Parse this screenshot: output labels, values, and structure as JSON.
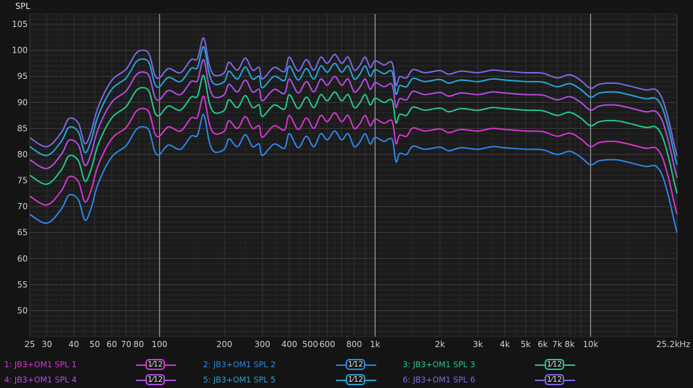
{
  "chart_data": {
    "type": "line",
    "ylabel": "SPL",
    "x_unit_label": "Hz",
    "x_scale": "log",
    "xlim": [
      25,
      25200
    ],
    "ylim": [
      45,
      107
    ],
    "grid": true,
    "y_ticks": [
      50,
      55,
      60,
      65,
      70,
      75,
      80,
      85,
      90,
      95,
      100,
      105
    ],
    "x_ticks": [
      {
        "f": 25,
        "label": "25"
      },
      {
        "f": 30,
        "label": "30"
      },
      {
        "f": 40,
        "label": "40"
      },
      {
        "f": 50,
        "label": "50"
      },
      {
        "f": 60,
        "label": "60"
      },
      {
        "f": 70,
        "label": "70"
      },
      {
        "f": 80,
        "label": "80"
      },
      {
        "f": 100,
        "label": "100"
      },
      {
        "f": 200,
        "label": "200"
      },
      {
        "f": 300,
        "label": "300"
      },
      {
        "f": 400,
        "label": "400"
      },
      {
        "f": 500,
        "label": "500"
      },
      {
        "f": 600,
        "label": "600"
      },
      {
        "f": 800,
        "label": "800"
      },
      {
        "f": 1000,
        "label": "1k"
      },
      {
        "f": 2000,
        "label": "2k"
      },
      {
        "f": 3000,
        "label": "3k"
      },
      {
        "f": 4000,
        "label": "4k"
      },
      {
        "f": 5000,
        "label": "5k"
      },
      {
        "f": 6000,
        "label": "6k"
      },
      {
        "f": 7000,
        "label": "7k"
      },
      {
        "f": 8000,
        "label": "8k"
      },
      {
        "f": 10000,
        "label": "10k"
      },
      {
        "f": 25200,
        "label": "25.2kHz"
      }
    ],
    "base_curve": {
      "x": [
        25,
        30,
        35,
        38,
        42,
        45,
        48,
        52,
        60,
        70,
        78,
        85,
        90,
        95,
        100,
        110,
        125,
        140,
        150,
        160,
        170,
        180,
        200,
        210,
        230,
        250,
        270,
        290,
        300,
        340,
        380,
        400,
        440,
        480,
        520,
        560,
        600,
        650,
        700,
        750,
        800,
        850,
        900,
        950,
        1000,
        1100,
        1200,
        1250,
        1300,
        1400,
        1500,
        1700,
        2000,
        2200,
        2500,
        3000,
        3500,
        4000,
        5000,
        6000,
        7000,
        8000,
        9000,
        10000,
        11000,
        13000,
        15000,
        18000,
        20000,
        21500,
        23000,
        24500,
        25200
      ],
      "y": [
        68.5,
        66.8,
        69.5,
        72.2,
        71.3,
        67.4,
        69.5,
        74.5,
        79.5,
        81.7,
        84.8,
        85.3,
        84.3,
        80.6,
        80.0,
        81.8,
        81.0,
        83.5,
        83.7,
        87.7,
        82.5,
        80.5,
        81.0,
        83.0,
        81.5,
        83.8,
        81.5,
        82.0,
        79.8,
        82.0,
        81.2,
        84.0,
        81.3,
        83.5,
        81.5,
        84.0,
        82.8,
        84.5,
        82.8,
        84.0,
        81.5,
        82.4,
        84.0,
        82.0,
        83.3,
        82.5,
        82.9,
        78.6,
        80.2,
        80.0,
        81.6,
        81.0,
        81.4,
        80.7,
        81.3,
        81.0,
        81.5,
        81.3,
        81.0,
        80.9,
        80.0,
        80.6,
        79.5,
        78.0,
        78.8,
        79.0,
        78.5,
        77.7,
        77.8,
        76.0,
        72.0,
        67.0,
        65.0
      ]
    },
    "series": [
      {
        "name": "1: JB3+OM1 SPL 1",
        "offset": 0,
        "color": "#2f86e8"
      },
      {
        "name": "2: JB3+OM1 SPL 2",
        "offset": 3.5,
        "color": "#d736d1"
      },
      {
        "name": "3: JB3+OM1 SPL 3",
        "offset": 7.5,
        "color": "#25c98c"
      },
      {
        "name": "4: JB3+OM1 SPL 4",
        "offset": 10.5,
        "color": "#b34de6"
      },
      {
        "name": "5: JB3+OM1 SPL 5",
        "offset": 13.0,
        "color": "#27a6d6"
      },
      {
        "name": "6: JB3+OM1 SPL 6",
        "offset": 14.7,
        "color": "#7a6ae8"
      }
    ]
  },
  "legend": [
    {
      "label": "1: JB3+OM1 SPL 1",
      "color": "#d736d1",
      "smoothing": "1⁄12"
    },
    {
      "label": "2: JB3+OM1 SPL 2",
      "color": "#2f86e8",
      "smoothing": "1⁄12"
    },
    {
      "label": "3: JB3+OM1 SPL 3",
      "color": "#25c98c",
      "smoothing": "1⁄12"
    },
    {
      "label": "4: JB3+OM1 SPL 4",
      "color": "#b34de6",
      "smoothing": "1⁄12"
    },
    {
      "label": "5: JB3+OM1 SPL 5",
      "color": "#27a6d6",
      "smoothing": "1⁄12"
    },
    {
      "label": "6: JB3+OM1 SPL 6",
      "color": "#7a6ae8",
      "smoothing": "1⁄12"
    }
  ]
}
